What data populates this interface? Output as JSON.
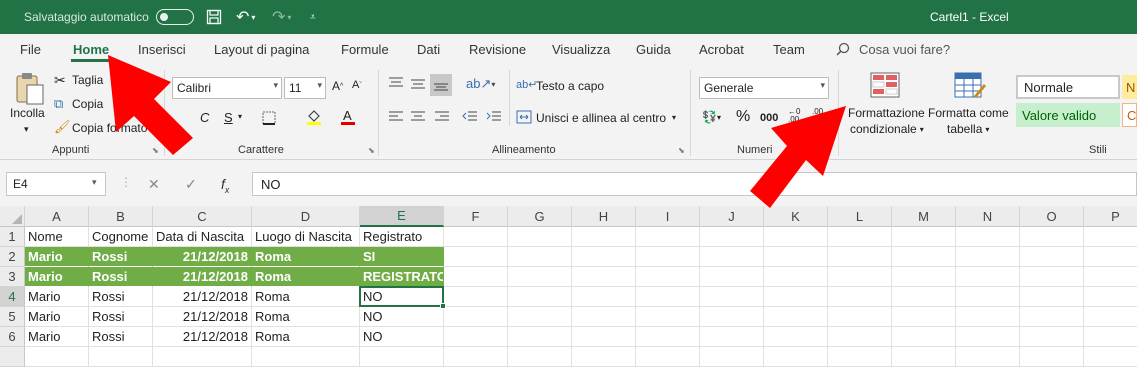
{
  "title_bar": {
    "autosave_label": "Salvataggio automatico",
    "document_title": "Cartel1  -  Excel"
  },
  "menu": {
    "tabs": [
      "File",
      "Home",
      "Inserisci",
      "Layout di pagina",
      "Formule",
      "Dati",
      "Revisione",
      "Visualizza",
      "Guida",
      "Acrobat",
      "Team"
    ],
    "active_tab": "Home",
    "tell_me": "Cosa vuoi fare?"
  },
  "ribbon": {
    "clipboard": {
      "paste": "Incolla",
      "cut": "Taglia",
      "copy": "Copia",
      "format_painter": "Copia formato",
      "group": "Appunti"
    },
    "font": {
      "name": "Calibri",
      "size": "11",
      "group": "Carattere"
    },
    "alignment": {
      "wrap": "Testo a capo",
      "merge": "Unisci e allinea al centro",
      "group": "Allineamento"
    },
    "number": {
      "format": "Generale",
      "group": "Numeri"
    },
    "styles": {
      "conditional_line1": "Formattazione",
      "conditional_line2": "condizionale",
      "table_line1": "Formatta come",
      "table_line2": "tabella",
      "style_normal": "Normale",
      "style_valid": "Valore valido",
      "group": "Stili"
    }
  },
  "formula_bar": {
    "name_box": "E4",
    "formula": "NO"
  },
  "sheet": {
    "columns": [
      "A",
      "B",
      "C",
      "D",
      "E",
      "F",
      "G",
      "H",
      "I",
      "J",
      "K",
      "L",
      "M",
      "N",
      "O",
      "P"
    ],
    "selected_column": "E",
    "selected_row": "4",
    "row_numbers": [
      "1",
      "2",
      "3",
      "4",
      "5",
      "6",
      ""
    ],
    "rows": [
      [
        "Nome",
        "Cognome",
        "Data di Nascita",
        "Luogo di Nascita",
        "Registrato"
      ],
      [
        "Mario",
        "Rossi",
        "21/12/2018",
        "Roma",
        "SI"
      ],
      [
        "Mario",
        "Rossi",
        "21/12/2018",
        "Roma",
        "REGISTRATO"
      ],
      [
        "Mario",
        "Rossi",
        "21/12/2018",
        "Roma",
        "NO"
      ],
      [
        "Mario",
        "Rossi",
        "21/12/2018",
        "Roma",
        "NO"
      ],
      [
        "Mario",
        "Rossi",
        "21/12/2018",
        "Roma",
        "NO"
      ]
    ],
    "highlight_color": "#70ad47"
  },
  "annotations": {
    "arrow_color": "#ff0000"
  },
  "colors": {
    "accent": "#217346"
  }
}
